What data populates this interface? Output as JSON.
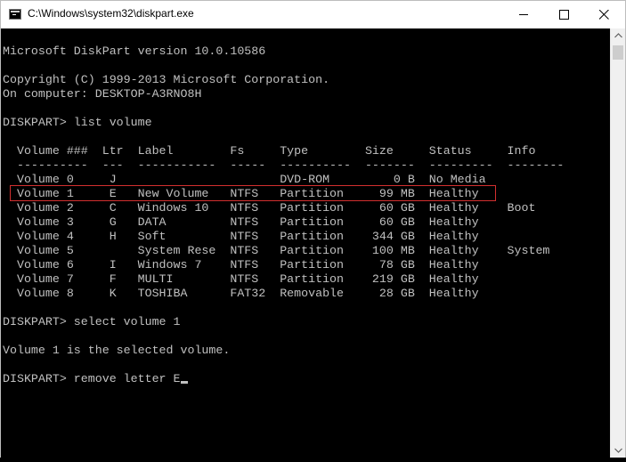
{
  "window": {
    "title": "C:\\Windows\\system32\\diskpart.exe",
    "icon": "console-app-icon",
    "controls": {
      "minimize": "minimize-icon",
      "maximize": "maximize-icon",
      "close": "close-icon"
    }
  },
  "console": {
    "lines": [
      "Microsoft DiskPart version 10.0.10586",
      "",
      "Copyright (C) 1999-2013 Microsoft Corporation.",
      "On computer: DESKTOP-A3RNO8H",
      "",
      "DISKPART> list volume",
      "",
      "  Volume ###  Ltr  Label        Fs     Type        Size     Status     Info",
      "  ----------  ---  -----------  -----  ----------  -------  ---------  --------",
      "  Volume 0     J                       DVD-ROM         0 B  No Media",
      "  Volume 1     E   New Volume   NTFS   Partition     99 MB  Healthy",
      "  Volume 2     C   Windows 10   NTFS   Partition     60 GB  Healthy    Boot",
      "  Volume 3     G   DATA         NTFS   Partition     60 GB  Healthy",
      "  Volume 4     H   Soft         NTFS   Partition    344 GB  Healthy",
      "  Volume 5         System Rese  NTFS   Partition    100 MB  Healthy    System",
      "  Volume 6     I   Windows 7    NTFS   Partition     78 GB  Healthy",
      "  Volume 7     F   MULTI        NTFS   Partition    219 GB  Healthy",
      "  Volume 8     K   TOSHIBA      FAT32  Removable     28 GB  Healthy",
      "",
      "DISKPART> select volume 1",
      "",
      "Volume 1 is the selected volume.",
      "",
      "DISKPART> remove letter E"
    ],
    "highlighted_row": "Volume 1",
    "text_color": "#c0c0c0",
    "background_color": "#000000",
    "highlight_color": "#d32f2f"
  }
}
